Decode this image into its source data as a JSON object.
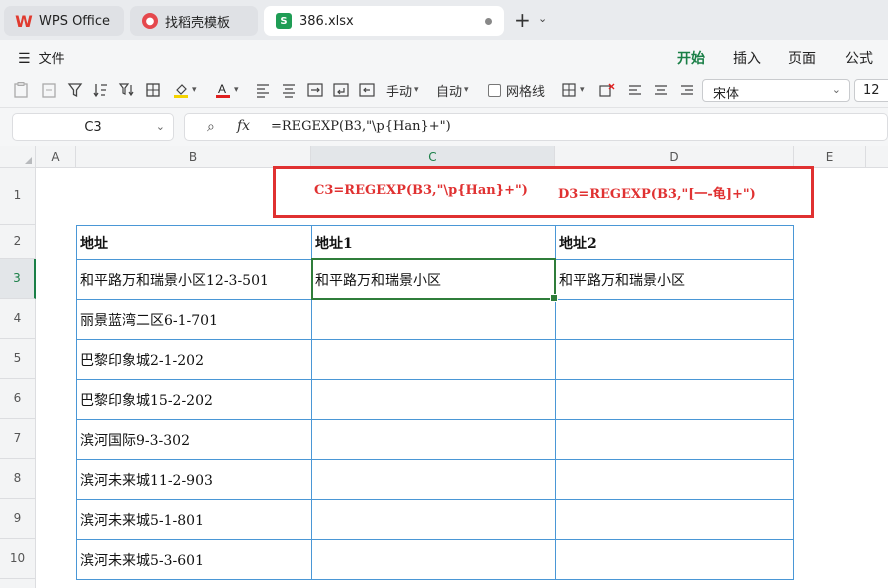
{
  "tabs": {
    "wps": "WPS Office",
    "docer": "找稻壳模板",
    "file": "386.xlsx",
    "file_icon_letter": "S",
    "add": "+"
  },
  "menu": {
    "file": "文件",
    "ribbon_tabs": [
      "开始",
      "插入",
      "页面",
      "公式"
    ]
  },
  "toolbar": {
    "wrap_label": "手动",
    "auto_label": "自动",
    "gridlines_label": "网格线",
    "font_name": "宋体",
    "font_size": "12"
  },
  "formula_bar": {
    "name_box": "C3",
    "fx": "fx",
    "formula": "=REGEXP(B3,\"\\p{Han}+\")"
  },
  "sheet": {
    "columns": [
      "A",
      "B",
      "C",
      "D",
      "E"
    ],
    "rows": [
      "1",
      "2",
      "3",
      "4",
      "5",
      "6",
      "7",
      "8",
      "9",
      "10"
    ],
    "annotation": {
      "c3": "C3=REGEXP(B3,\"\\p{Han}+\")",
      "d3": "D3=REGEXP(B3,\"[一-龟]+\")"
    },
    "headers": {
      "b": "地址",
      "c": "地址1",
      "d": "地址2"
    },
    "b_values": [
      "和平路万和瑞景小区12-3-501",
      "丽景蓝湾二区6-1-701",
      "巴黎印象城2-1-202",
      "巴黎印象城15-2-202",
      "滨河国际9-3-302",
      "滨河未来城11-2-903",
      "滨河未来城5-1-801",
      "滨河未来城5-3-601"
    ],
    "c3": "和平路万和瑞景小区",
    "d3": "和平路万和瑞景小区"
  },
  "colors": {
    "accent_green": "#1a7f47",
    "annotation_red": "#e03131",
    "table_border_blue": "#4a97d6"
  }
}
